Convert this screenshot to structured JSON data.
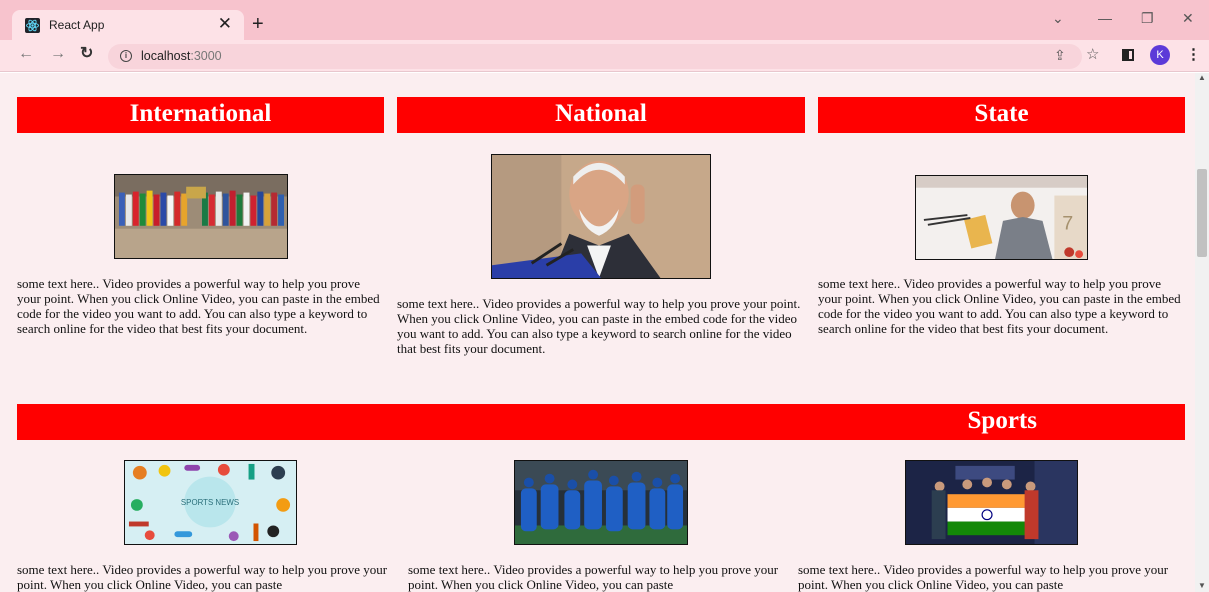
{
  "browser": {
    "tab_title": "React App",
    "url_host": "localhost",
    "url_port": ":3000",
    "avatar_initial": "K",
    "icons": [
      "react-favicon-icon",
      "close-icon",
      "plus-icon",
      "chevron-down-icon",
      "minimize-icon",
      "restore-icon",
      "close-window-icon",
      "back-arrow-icon",
      "forward-arrow-icon",
      "reload-icon",
      "info-icon",
      "share-icon",
      "star-icon",
      "side-panel-icon",
      "kebab-menu-icon"
    ]
  },
  "sections": {
    "international": {
      "title": "International",
      "image": "g20-flags-image"
    },
    "national": {
      "title": "National",
      "image": "politician-speaking-image"
    },
    "state": {
      "title": "State",
      "image": "minister-at-podium-image"
    },
    "sports": {
      "title": "Sports"
    }
  },
  "top_cards": {
    "international_text": "some text here.. Video provides a powerful way to help you prove your point. When you click Online Video, you can paste in the embed code for the video you want to add. You can also type a keyword to search online for the video that best fits your document.",
    "national_text": "some text here.. Video provides a powerful way to help you prove your point. When you click Online Video, you can paste in the embed code for the video you want to add. You can also type a keyword to search online for the video that best fits your document.",
    "state_text": "some text here.. Video provides a powerful way to help you prove your point. When you click Online Video, you can paste in the embed code for the video you want to add. You can also type a keyword to search online for the video that best fits your document."
  },
  "sports_cards": {
    "card1_text": "some text here.. Video provides a powerful way to help you prove your point. When you click Online Video, you can paste",
    "card1_image_text": "SPORTS NEWS",
    "card2_text": "some text here.. Video provides a powerful way to help you prove your point. When you click Online Video, you can paste",
    "card3_text": "some text here.. Video provides a powerful way to help you prove your point. When you click Online Video, you can paste"
  },
  "colors": {
    "header_bar": "#ff0000",
    "page_bg": "#fbeef0",
    "tabstrip": "#f7c3cd"
  }
}
